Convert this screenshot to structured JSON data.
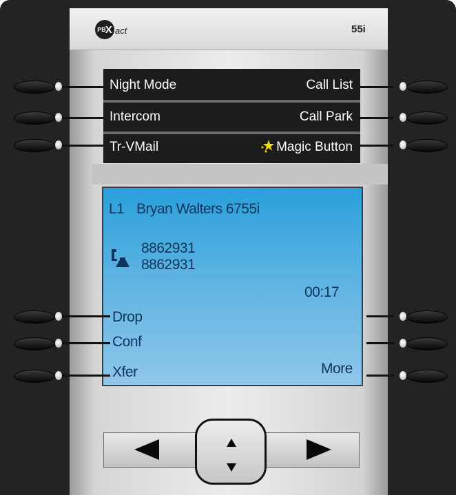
{
  "header": {
    "logo_mark": "PB",
    "logo_x": "X",
    "logo_text": "act",
    "model": "55i"
  },
  "programmable_keys": {
    "left": [
      "Night Mode",
      "Intercom",
      "Tr-VMail"
    ],
    "right": [
      "Call List",
      "Call Park",
      "Magic Button"
    ]
  },
  "screen": {
    "line_label": "L1",
    "caller_name": "Bryan Walters 6755i",
    "number_1": "8862931",
    "number_2": "8862931",
    "call_timer": "00:17",
    "softkeys_left": [
      "Drop",
      "Conf",
      "Xfer"
    ],
    "softkey_right": "More"
  },
  "icons": {
    "call": "phone-handset-icon",
    "magic": "star-icon",
    "nav_left": "arrow-left-icon",
    "nav_right": "arrow-right-icon",
    "nav_up": "arrow-up-icon",
    "nav_down": "arrow-down-icon"
  },
  "colors": {
    "bezel": "#232323",
    "faceplate": "#ececec",
    "top_display": "#1c1c1c",
    "lcd": "#5cb3e2",
    "lcd_text": "#10345c",
    "star": "#f5d700"
  }
}
